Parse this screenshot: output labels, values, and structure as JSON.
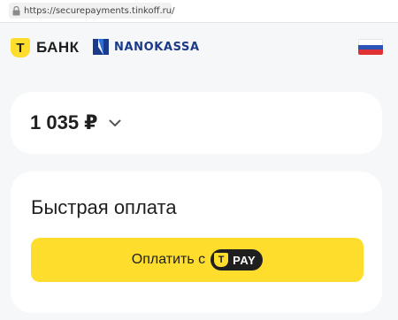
{
  "browser": {
    "url": "https://securepayments.tinkoff.ru/"
  },
  "header": {
    "tbank_mark": "Т",
    "tbank_name": "БАНК",
    "partner_name": "NANOKASSA",
    "language_flag": "russia-flag"
  },
  "amount": {
    "value": "1 035 ₽",
    "expand_icon": "chevron-down-icon"
  },
  "payment": {
    "title": "Быстрая оплата",
    "button_label": "Оплатить с",
    "badge_mark": "Т",
    "badge_text": "PAY"
  },
  "colors": {
    "brand_yellow": "#ffdd2d",
    "page_bg": "#f6f7f8",
    "card_bg": "#ffffff",
    "nano_blue": "#1b3a8a"
  }
}
